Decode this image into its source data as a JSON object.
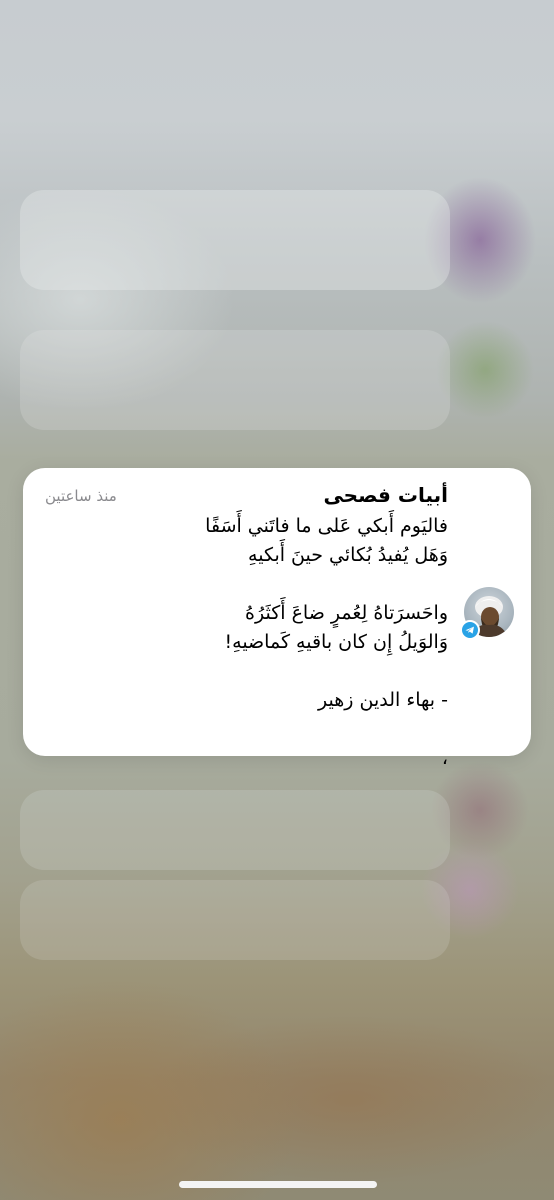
{
  "notification": {
    "title": "أبيات فصحى",
    "time": "منذ ساعتين",
    "app_badge_icon": "telegram-icon",
    "avatar_icon": "profile-avatar",
    "lines": [
      "فاليَوم أَبكي عَلى ما فاتَني أَسَفًا",
      "وَهَل يُفيدُ بُكائي حينَ أَبكيهِ",
      "",
      "واحَسرَتاهُ لِعُمرٍ ضاعَ أَكثَرُهُ",
      "وَالوَيلُ إِن كان باقيهِ كَماضيهِ!",
      "",
      "- بهاء الدين زهير",
      "",
      "،"
    ]
  },
  "colors": {
    "card_background": "#ffffff",
    "time_text": "#8a8a8e",
    "badge_blue": "#2aa3e6",
    "home_indicator": "#f4f4f4"
  }
}
